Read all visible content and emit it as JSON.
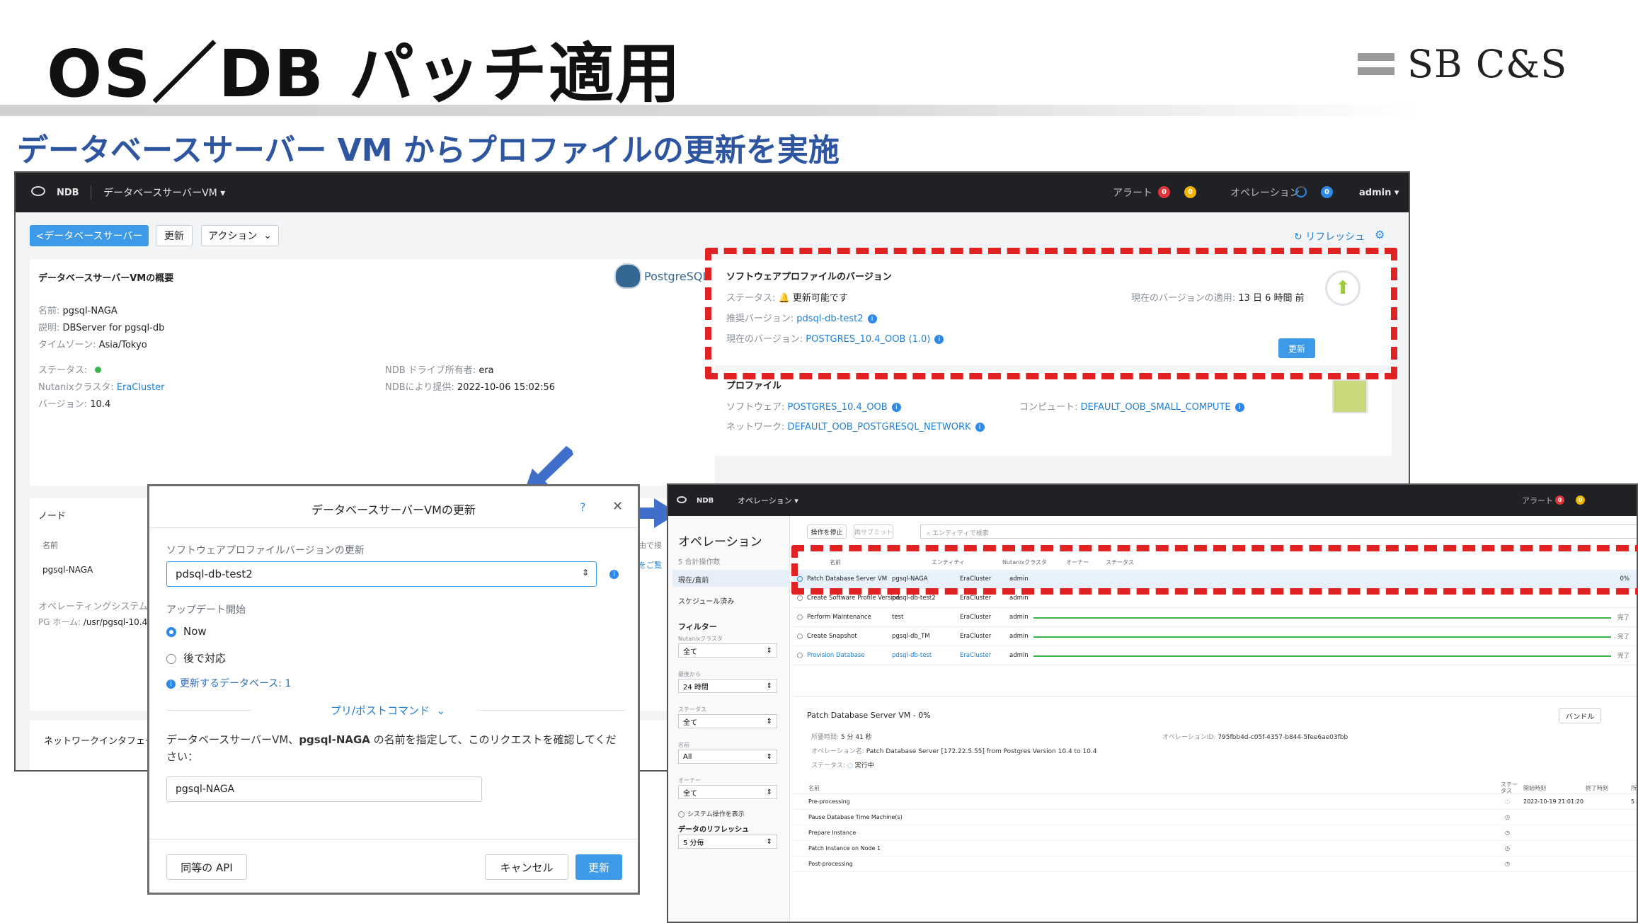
{
  "slide": {
    "title": "OS／DB パッチ適用",
    "subtitle": "データベースサーバー VM からプロファイルの更新を実施",
    "logo_text": "SB C&S"
  },
  "s1": {
    "brand": "NDB",
    "context": "データベースサーバーVM",
    "alert_label": "アラート",
    "alert_red": "0",
    "alert_yellow": "0",
    "ops_label": "オペレーション",
    "ops_count": "0",
    "user": "admin",
    "back_btn": "<データベースサーバー",
    "update_btn": "更新",
    "action_btn": "アクション",
    "refresh": "リフレッシュ",
    "summary_title": "データベースサーバーVMの概要",
    "pg_logo": "PostgreSQL",
    "name_lbl": "名前:",
    "name_val": "pgsql-NAGA",
    "desc_lbl": "説明:",
    "desc_val": "DBServer for pgsql-db",
    "tz_lbl": "タイムゾーン:",
    "tz_val": "Asia/Tokyo",
    "status_lbl": "ステータス:",
    "cluster_lbl": "Nutanixクラスタ:",
    "cluster_val": "EraCluster",
    "version_lbl": "バージョン:",
    "version_val": "10.4",
    "owner_lbl": "NDB ドライブ所有者:",
    "owner_val": "era",
    "provided_lbl": "NDBにより提供:",
    "provided_val": "2022-10-06 15:02:56",
    "swver_title": "ソフトウェアプロファイルのバージョン",
    "sw_status_lbl": "ステータス:",
    "sw_status_val": "更新可能です",
    "applied_lbl": "現在のバージョンの適用:",
    "applied_val": "13 日 6 時間 前",
    "rec_lbl": "推奨バージョン:",
    "rec_val": "pdsql-db-test2",
    "cur_lbl": "現在のバージョン:",
    "cur_val": "POSTGRES_10.4_OOB (1.0)",
    "sw_update_btn": "更新",
    "profile_title": "プロファイル",
    "software_lbl": "ソフトウェア:",
    "software_val": "POSTGRES_10.4_OOB",
    "compute_lbl": "コンピュート:",
    "compute_val": "DEFAULT_OOB_SMALL_COMPUTE",
    "network_lbl": "ネットワーク:",
    "network_val": "DEFAULT_OOB_POSTGRESQL_NETWORK",
    "node_title": "ノード",
    "node_name_hdr": "名前",
    "node_name": "pgsql-NAGA",
    "os_lbl": "オペレーティングシステム",
    "pghome_lbl": "PG ホーム:",
    "pghome_val": "/usr/pgsql-10.4",
    "net_if": "ネットワークインタフェース",
    "partial1": "由で接",
    "partial2": "をご覧"
  },
  "modal": {
    "title": "データベースサーバーVMの更新",
    "help": "?",
    "close": "✕",
    "sw_label": "ソフトウェアプロファイルバージョンの更新",
    "sw_value": "pdsql-db-test2",
    "start_label": "アップデート開始",
    "opt_now": "Now",
    "opt_later": "後で対応",
    "db_count": "更新するデータベース: 1",
    "prepost": "プリ/ポストコマンド",
    "confirm_pre": "データベースサーバーVM、",
    "confirm_bold": "pgsql-NAGA",
    "confirm_post": " の名前を指定して、このリクエストを確認してください：",
    "confirm_value": "pgsql-NAGA",
    "api_btn": "同等の API",
    "cancel_btn": "キャンセル",
    "update_btn": "更新"
  },
  "s2": {
    "brand": "NDB",
    "context": "オペレーション",
    "alert_label": "アラート",
    "alert_red": "0",
    "alert_yellow": "0",
    "side_title": "オペレーション",
    "side_count": "5 合計操作数",
    "side_current": "現在/直前",
    "side_sched": "スケジュール済み",
    "filter": "フィルター",
    "f_cluster": "Nutanixクラスタ",
    "f_cluster_v": "全て",
    "f_since": "最後から",
    "f_since_v": "24 時間",
    "f_status": "ステータス",
    "f_status_v": "全て",
    "f_name": "名前",
    "f_name_v": "All",
    "f_owner": "オーナー",
    "f_owner_v": "全て",
    "f_sys": "システム操作を表示",
    "f_refresh": "データのリフレッシュ",
    "f_refresh_v": "5 分毎",
    "tab_cancel": "操作を停止",
    "tab_resubmit": "再サブミット",
    "search_ph": "エンティティで検索",
    "h_name": "名前",
    "h_entity": "エンティティ",
    "h_cluster": "Nutanixクラスタ",
    "h_owner": "オーナー",
    "h_status": "ステータス",
    "rows": [
      {
        "name": "Patch Database Server VM",
        "entity": "pgsql-NAGA",
        "cluster": "EraCluster",
        "owner": "admin",
        "pct": "0%",
        "done": ""
      },
      {
        "name": "Create Software Profile Version",
        "entity": "pdsql-db-test2",
        "cluster": "EraCluster",
        "owner": "admin",
        "pct": "",
        "done": ""
      },
      {
        "name": "Perform Maintenance",
        "entity": "test",
        "cluster": "EraCluster",
        "owner": "admin",
        "pct": "",
        "done": "完了"
      },
      {
        "name": "Create Snapshot",
        "entity": "pgsql-db_TM",
        "cluster": "EraCluster",
        "owner": "admin",
        "pct": "",
        "done": "完了"
      },
      {
        "name": "Provision Database",
        "entity": "pdsql-db-test",
        "cluster": "EraCluster",
        "owner": "admin",
        "pct": "",
        "done": "完了"
      }
    ],
    "detail_title": "Patch Database Server VM - 0%",
    "bundle_btn": "バンドル",
    "elapsed_lbl": "所要時間:",
    "elapsed_val": "5 分 41 秒",
    "opid_lbl": "オペレーションID:",
    "opid_val": "795fbb4d-c05f-4357-b844-5fee6ae03fbb",
    "opname_lbl": "オペレーション名:",
    "opname_val": "Patch Database Server [172.22.5.55] from Postgres Version 10.4 to 10.4",
    "state_lbl": "ステータス:",
    "state_val": "実行中",
    "d_name": "名前",
    "d_status": "ステータス",
    "d_start": "開始時刻",
    "d_end": "終了時刻",
    "d_dur": "所",
    "steps": [
      {
        "name": "Pre-processing",
        "start": "2022-10-19 21:01:20",
        "dur": "5"
      },
      {
        "name": "Pause Database Time Machine(s)",
        "start": "",
        "dur": ""
      },
      {
        "name": "Prepare Instance",
        "start": "",
        "dur": ""
      },
      {
        "name": "Patch Instance on Node 1",
        "start": "",
        "dur": ""
      },
      {
        "name": "Post-processing",
        "start": "",
        "dur": ""
      }
    ]
  },
  "colors": {
    "accent": "#3d9ae8",
    "highlight": "#e02222",
    "arrow": "#3f6fcb",
    "title_blue": "#2e56a0"
  }
}
